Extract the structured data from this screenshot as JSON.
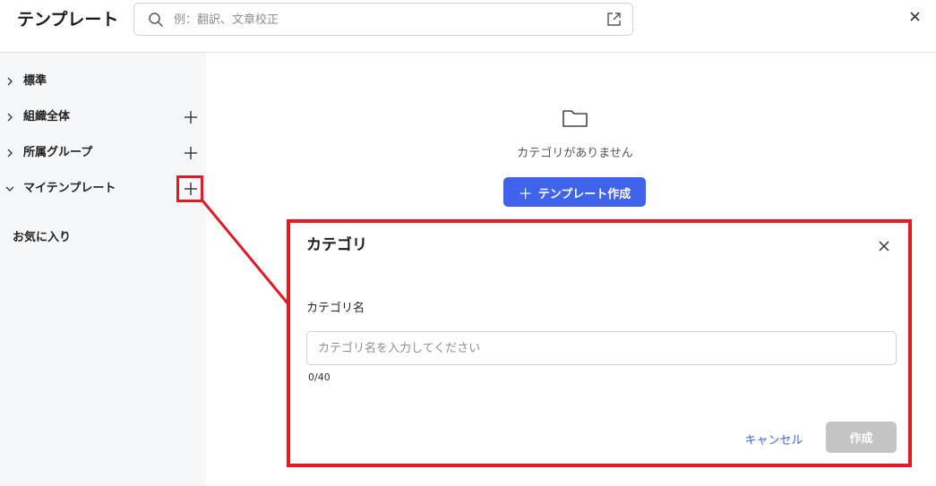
{
  "header": {
    "title": "テンプレート",
    "search_placeholder": "例：翻訳、文章校正",
    "search_value": ""
  },
  "sidebar": {
    "items": [
      {
        "label": "標準",
        "expanded": false,
        "has_add": false
      },
      {
        "label": "組織全体",
        "expanded": false,
        "has_add": true
      },
      {
        "label": "所属グループ",
        "expanded": false,
        "has_add": true
      },
      {
        "label": "マイテンプレート",
        "expanded": true,
        "has_add": true
      }
    ],
    "favorites_label": "お気に入り"
  },
  "main": {
    "empty_message": "カテゴリがありません",
    "create_button_label": "テンプレート作成"
  },
  "dialog": {
    "title": "カテゴリ",
    "field_label": "カテゴリ名",
    "input_placeholder": "カテゴリ名を入力してください",
    "input_value": "",
    "counter": "0/40",
    "cancel_label": "キャンセル",
    "submit_label": "作成"
  },
  "colors": {
    "accent": "#3f63ea",
    "highlight": "#e01b24",
    "disabled": "#c2c4c7",
    "sidebar_bg": "#f6f7f9"
  }
}
